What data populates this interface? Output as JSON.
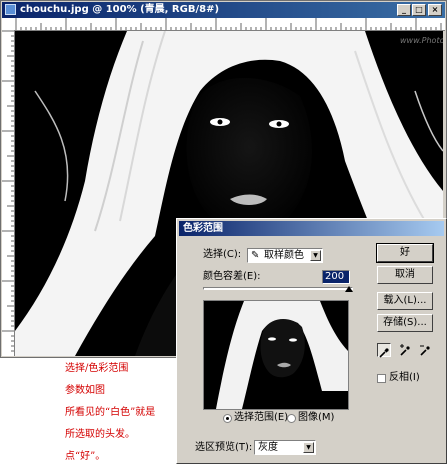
{
  "document": {
    "title": "chouchu.jpg @ 100% (青晨, RGB/8#)",
    "watermark": "www.PhotoPs.com"
  },
  "dialog": {
    "title": "色彩范围",
    "select_label": "选择(C):",
    "select_value": "取样颜色",
    "fuzziness_label": "颜色容差(E):",
    "fuzziness_value": "200",
    "fuzziness_level": 1.0,
    "radio_selection": "选择范围(E)",
    "radio_image": "图像(M)",
    "preview_label": "选区预览(T):",
    "preview_value": "灰度",
    "buttons": {
      "ok": "好",
      "cancel": "取消",
      "load": "载入(L)...",
      "save": "存储(S)..."
    },
    "invert_label": "反相(I)",
    "eyedropper_icons": [
      "eyedropper-icon",
      "eyedropper-plus-icon",
      "eyedropper-minus-icon"
    ]
  },
  "notes": [
    "选择/色彩范围",
    "参数如图",
    "所看见的“白色”就是",
    "所选取的头发。",
    "点“好”。"
  ],
  "colors": {
    "title_bar": "#0a246a",
    "dialog_bg": "#d4d0c8",
    "note_text": "#d40000",
    "field_highlight": "#0a246a"
  }
}
